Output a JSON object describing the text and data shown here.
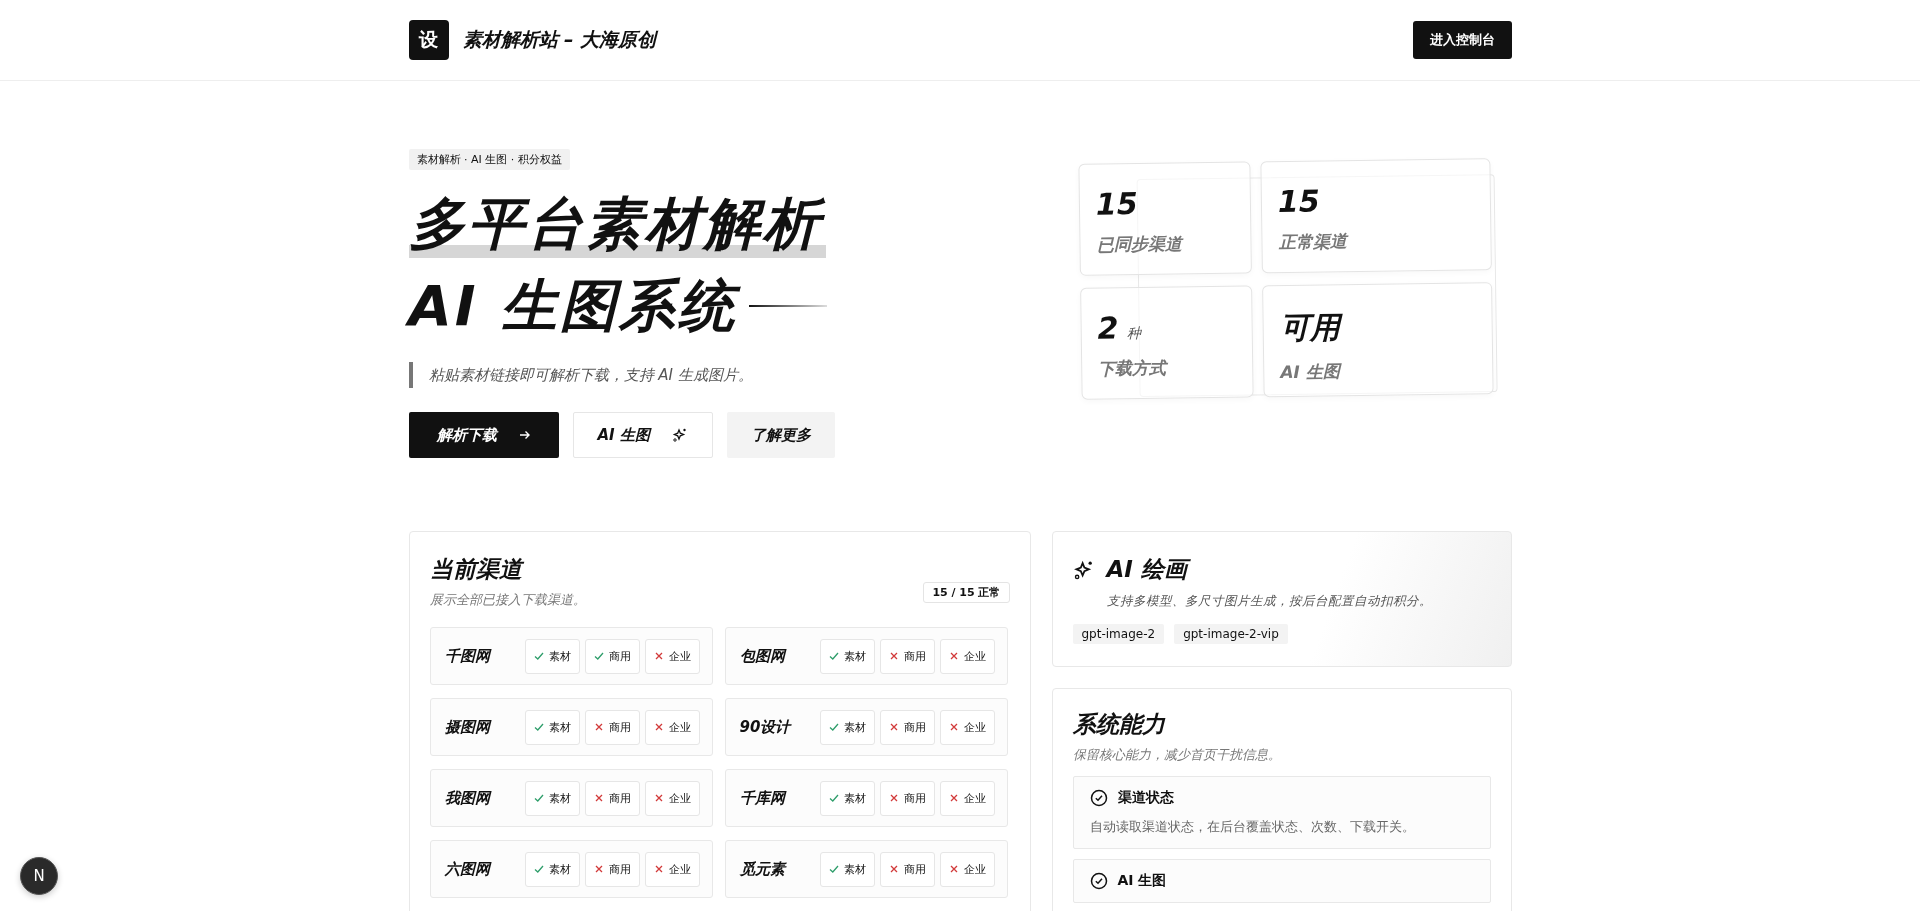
{
  "header": {
    "logo": "设",
    "site_title": "素材解析站 – 大海原创",
    "console_button": "进入控制台"
  },
  "hero": {
    "tag": "素材解析 · AI 生图 · 积分权益",
    "title_line_1": "多平台素材解析",
    "title_line_2": "AI 生图系统",
    "subtitle": "粘贴素材链接即可解析下载，支持 AI 生成图片。",
    "buttons": [
      {
        "label": "解析下载",
        "kind": "primary"
      },
      {
        "label": "AI 生图",
        "kind": "outline"
      },
      {
        "label": "了解更多",
        "kind": "muted"
      }
    ]
  },
  "stats": [
    {
      "value": "15",
      "label": "已同步渠道"
    },
    {
      "value": "15",
      "label": "正常渠道"
    },
    {
      "value": "2",
      "unit": "种",
      "label": "下载方式"
    },
    {
      "value": "可用",
      "label": "AI 生图"
    }
  ],
  "channels_panel": {
    "title": "当前渠道",
    "subtitle": "展示全部已接入下载渠道。",
    "count_badge": "15 / 15 正常",
    "channels": [
      {
        "name": "千图网",
        "tags": [
          {
            "label": "素材",
            "ok": true
          },
          {
            "label": "商用",
            "ok": true
          },
          {
            "label": "企业",
            "ok": false
          }
        ]
      },
      {
        "name": "包图网",
        "tags": [
          {
            "label": "素材",
            "ok": true
          },
          {
            "label": "商用",
            "ok": false
          },
          {
            "label": "企业",
            "ok": false
          }
        ]
      },
      {
        "name": "摄图网",
        "tags": [
          {
            "label": "素材",
            "ok": true
          },
          {
            "label": "商用",
            "ok": false
          },
          {
            "label": "企业",
            "ok": false
          }
        ]
      },
      {
        "name": "90设计",
        "tags": [
          {
            "label": "素材",
            "ok": true
          },
          {
            "label": "商用",
            "ok": false
          },
          {
            "label": "企业",
            "ok": false
          }
        ]
      },
      {
        "name": "我图网",
        "tags": [
          {
            "label": "素材",
            "ok": true
          },
          {
            "label": "商用",
            "ok": false
          },
          {
            "label": "企业",
            "ok": false
          }
        ]
      },
      {
        "name": "千库网",
        "tags": [
          {
            "label": "素材",
            "ok": true
          },
          {
            "label": "商用",
            "ok": false
          },
          {
            "label": "企业",
            "ok": false
          }
        ]
      },
      {
        "name": "六图网",
        "tags": [
          {
            "label": "素材",
            "ok": true
          },
          {
            "label": "商用",
            "ok": false
          },
          {
            "label": "企业",
            "ok": false
          }
        ]
      },
      {
        "name": "觅元素",
        "tags": [
          {
            "label": "素材",
            "ok": true
          },
          {
            "label": "商用",
            "ok": false
          },
          {
            "label": "企业",
            "ok": false
          }
        ]
      }
    ]
  },
  "ai_panel": {
    "title": "AI 绘画",
    "description": "支持多模型、多尺寸图片生成，按后台配置自动扣积分。",
    "models": [
      "gpt-image-2",
      "gpt-image-2-vip"
    ]
  },
  "system_panel": {
    "title": "系统能力",
    "subtitle": "保留核心能力，减少首页干扰信息。",
    "features": [
      {
        "title": "渠道状态",
        "description": "自动读取渠道状态，在后台覆盖状态、次数、下载开关。"
      },
      {
        "title": "AI 生图"
      }
    ]
  },
  "dev_badge": "N"
}
